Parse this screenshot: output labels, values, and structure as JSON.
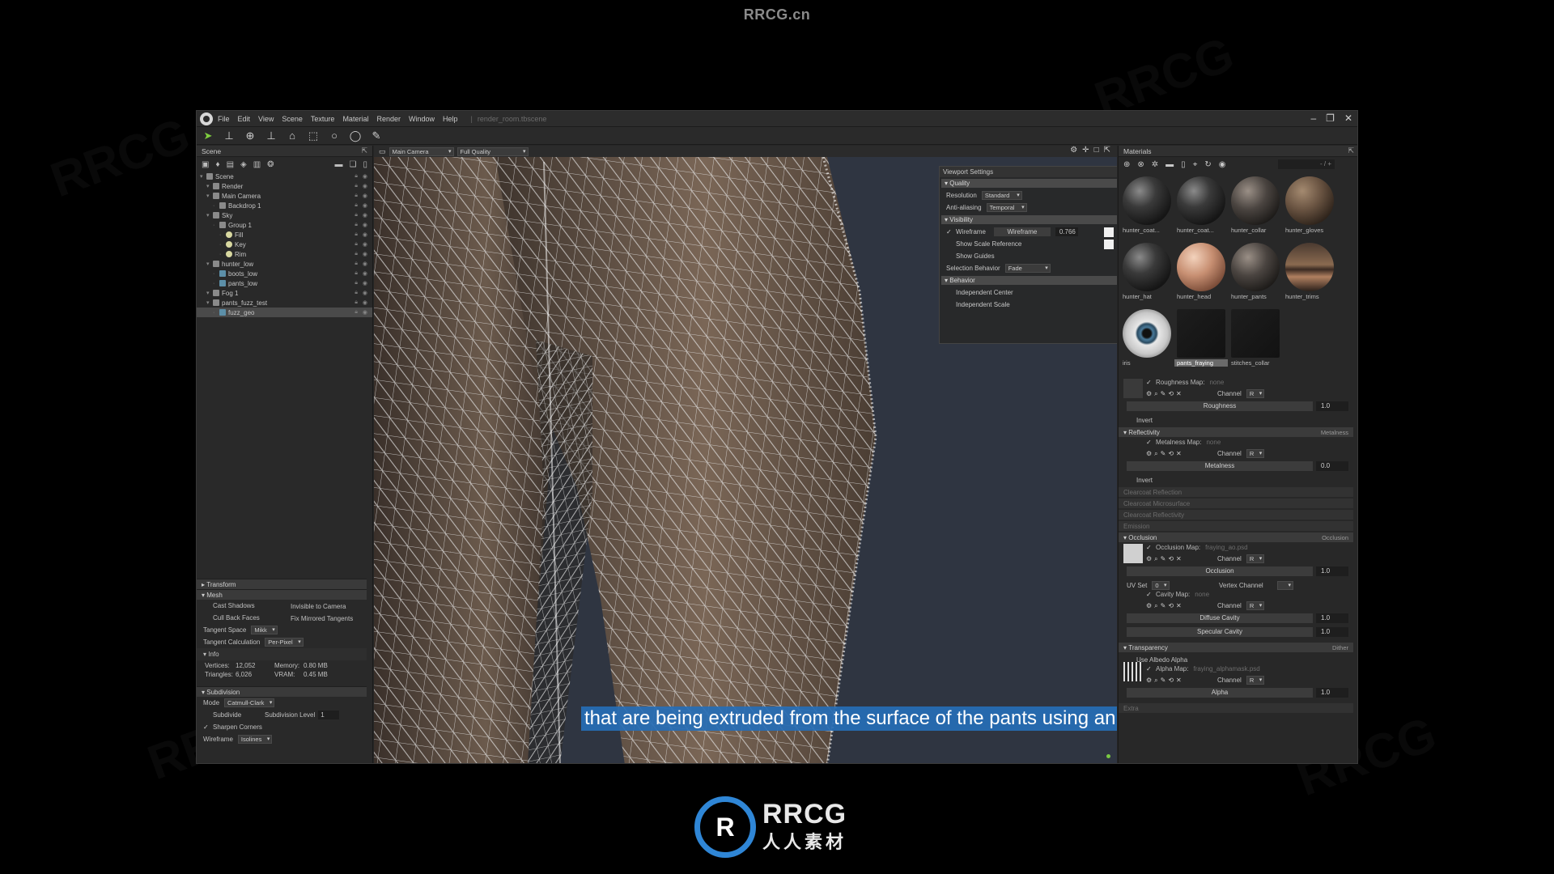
{
  "brand_top": "RRCG.cn",
  "title_bar": {
    "menus": [
      "File",
      "Edit",
      "View",
      "Scene",
      "Texture",
      "Material",
      "Render",
      "Window",
      "Help"
    ],
    "file_name": "render_room.tbscene"
  },
  "scene_panel": {
    "title": "Scene",
    "items": [
      {
        "label": "Scene",
        "depth": 0,
        "type": "scene"
      },
      {
        "label": "Render",
        "depth": 1,
        "type": "node"
      },
      {
        "label": "Main Camera",
        "depth": 1,
        "type": "node"
      },
      {
        "label": "Backdrop 1",
        "depth": 2,
        "type": "node"
      },
      {
        "label": "Sky",
        "depth": 1,
        "type": "node"
      },
      {
        "label": "Group 1",
        "depth": 2,
        "type": "node"
      },
      {
        "label": "Fill",
        "depth": 3,
        "type": "light"
      },
      {
        "label": "Key",
        "depth": 3,
        "type": "light"
      },
      {
        "label": "Rim",
        "depth": 3,
        "type": "light"
      },
      {
        "label": "hunter_low",
        "depth": 1,
        "type": "node"
      },
      {
        "label": "boots_low",
        "depth": 2,
        "type": "mesh"
      },
      {
        "label": "pants_low",
        "depth": 2,
        "type": "mesh"
      },
      {
        "label": "Fog 1",
        "depth": 1,
        "type": "node"
      },
      {
        "label": "pants_fuzz_test",
        "depth": 1,
        "type": "node"
      },
      {
        "label": "fuzz_geo",
        "depth": 2,
        "type": "mesh",
        "selected": true
      }
    ]
  },
  "properties": {
    "transform_label": "Transform",
    "mesh_label": "Mesh",
    "cast_shadows": "Cast Shadows",
    "invisible_to_camera": "Invisible to Camera",
    "cull_back_faces": "Cull Back Faces",
    "fix_mirrored": "Fix Mirrored Tangents",
    "tangent_space_label": "Tangent Space",
    "tangent_space_value": "Mikk",
    "tangent_calc_label": "Tangent Calculation",
    "tangent_calc_value": "Per-Pixel",
    "info_label": "Info",
    "vertices_label": "Vertices:",
    "vertices_value": "12,052",
    "memory_label": "Memory:",
    "memory_value": "0.80 MB",
    "triangles_label": "Triangles:",
    "triangles_value": "6,026",
    "vram_label": "VRAM:",
    "vram_value": "0.45 MB",
    "subdivision_label": "Subdivision",
    "mode_label": "Mode",
    "mode_value": "Catmull-Clark",
    "subdivide_label": "Subdivide",
    "sub_level_label": "Subdivision Level",
    "sub_level_value": "1",
    "sharpen_corners": "Sharpen Corners",
    "wireframe_label": "Wireframe",
    "wireframe_value": "Isolines"
  },
  "viewport": {
    "camera": "Main Camera",
    "quality": "Full Quality",
    "settings": {
      "title": "Viewport Settings",
      "quality_sec": "Quality",
      "resolution_label": "Resolution",
      "resolution_value": "Standard",
      "aa_label": "Anti-aliasing",
      "aa_value": "Temporal",
      "visibility_sec": "Visibility",
      "wireframe_label": "Wireframe",
      "wireframe_slider": "Wireframe",
      "wireframe_value": "0.766",
      "scale_ref": "Show Scale Reference",
      "guides": "Show Guides",
      "sel_behavior_label": "Selection Behavior",
      "sel_behavior_value": "Fade",
      "behavior_sec": "Behavior",
      "indep_center": "Independent Center",
      "indep_scale": "Independent Scale"
    },
    "subtitle": "that are being extruded from the surface of the pants using an alpha map."
  },
  "materials_panel": {
    "title": "Materials",
    "search_text": "- / +",
    "materials": [
      {
        "name": "hunter_coat...",
        "style": "dark"
      },
      {
        "name": "hunter_coat...",
        "style": "dark"
      },
      {
        "name": "hunter_collar",
        "style": "wrinkle"
      },
      {
        "name": "hunter_gloves",
        "style": "leather"
      },
      {
        "name": "hunter_hat",
        "style": "dark"
      },
      {
        "name": "hunter_head",
        "style": "skin"
      },
      {
        "name": "hunter_pants",
        "style": "wrinkle"
      },
      {
        "name": "hunter_trims",
        "style": "metal"
      },
      {
        "name": "iris",
        "style": "eye"
      },
      {
        "name": "pants_fraying",
        "style": "black",
        "selected": true
      },
      {
        "name": "stitches_collar",
        "style": "black"
      }
    ],
    "roughness_map": "Roughness Map:",
    "roughness_map_val": "none",
    "channel": "Channel",
    "channel_val": "R",
    "roughness": "Roughness",
    "roughness_val": "1.0",
    "invert": "Invert",
    "reflectivity_sec": "Reflectivity",
    "reflectivity_right": "Metalness",
    "metalness_map": "Metalness Map:",
    "metalness_map_val": "none",
    "metalness": "Metalness",
    "metalness_val": "0.0",
    "clearcoat_reflection": "Clearcoat Reflection",
    "clearcoat_micro": "Clearcoat Microsurface",
    "clearcoat_refl": "Clearcoat Reflectivity",
    "emission": "Emission",
    "occlusion_sec": "Occlusion",
    "occlusion_right": "Occlusion",
    "occlusion_map": "Occlusion Map:",
    "occlusion_map_val": "fraying_ao.psd",
    "occlusion": "Occlusion",
    "occlusion_val": "1.0",
    "uv_set": "UV Set",
    "uv_set_val": "0",
    "vertex_channel": "Vertex Channel",
    "cavity_map": "Cavity Map:",
    "cavity_map_val": "none",
    "diffuse_cavity": "Diffuse Cavity",
    "diffuse_cavity_val": "1.0",
    "specular_cavity": "Specular Cavity",
    "specular_cavity_val": "1.0",
    "transparency_sec": "Transparency",
    "transparency_right": "Dither",
    "use_albedo_alpha": "Use Albedo Alpha",
    "alpha_map": "Alpha Map:",
    "alpha_map_val": "fraying_alphamask.psd",
    "alpha": "Alpha",
    "alpha_val": "1.0",
    "extra": "Extra"
  },
  "logo": {
    "big": "RRCG",
    "small": "人人素材",
    "mark": "R"
  }
}
